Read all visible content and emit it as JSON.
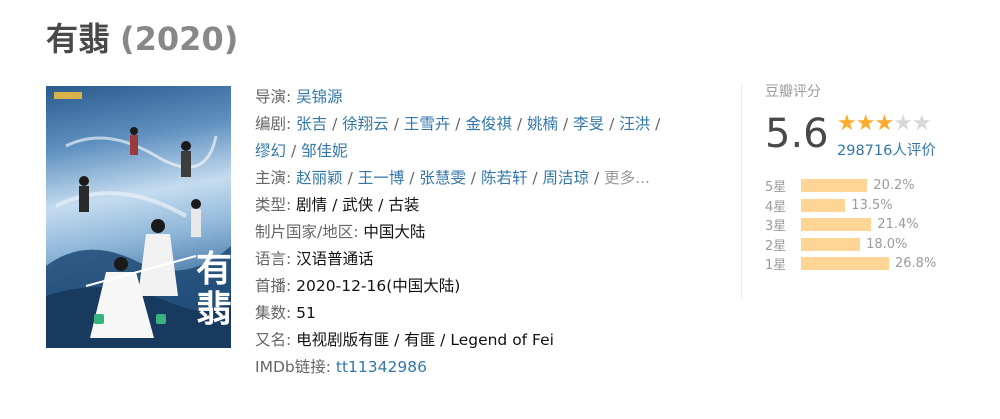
{
  "title": "有翡",
  "year": "(2020)",
  "info": {
    "director_label": "导演:",
    "director": "吴锦源",
    "writers_label": "编剧:",
    "writers": [
      "张吉",
      "徐翔云",
      "王雪卉",
      "金俊祺",
      "姚楠",
      "李旻",
      "汪洪",
      "缪幻",
      "邹佳妮"
    ],
    "cast_label": "主演:",
    "cast": [
      "赵丽颖",
      "王一博",
      "张慧雯",
      "陈若轩",
      "周洁琼"
    ],
    "cast_more": "更多...",
    "genre_label": "类型:",
    "genre": "剧情 / 武侠 / 古装",
    "country_label": "制片国家/地区:",
    "country": "中国大陆",
    "language_label": "语言:",
    "language": "汉语普通话",
    "premiere_label": "首播:",
    "premiere": "2020-12-16(中国大陆)",
    "episodes_label": "集数:",
    "episodes": "51",
    "aka_label": "又名:",
    "aka": "电视剧版有匪 / 有匪 / Legend of Fei",
    "imdb_label": "IMDb链接:",
    "imdb": "tt11342986"
  },
  "rating": {
    "label": "豆瓣评分",
    "score": "5.6",
    "stars_filled": 3,
    "stars_total": 5,
    "votes": "298716人评价",
    "distribution": [
      {
        "label": "5星",
        "pct": "20.2%",
        "value": 20.2
      },
      {
        "label": "4星",
        "pct": "13.5%",
        "value": 13.5
      },
      {
        "label": "3星",
        "pct": "21.4%",
        "value": 21.4
      },
      {
        "label": "2星",
        "pct": "18.0%",
        "value": 18.0
      },
      {
        "label": "1星",
        "pct": "26.8%",
        "value": 26.8
      }
    ],
    "bar_color": "#ffd596",
    "star_color": "#ffac2d",
    "link_color": "#3377aa"
  },
  "poster": {
    "calligraphy_1": "有",
    "calligraphy_2": "翡"
  }
}
